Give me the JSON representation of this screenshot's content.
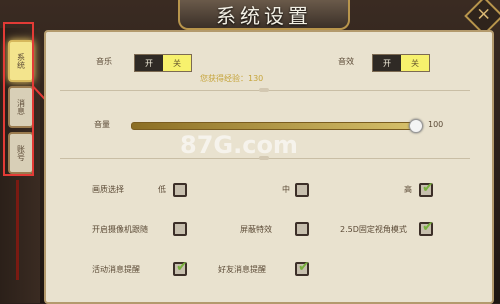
{
  "window": {
    "title": "系统设置",
    "close_icon": "close-icon"
  },
  "sidebar": {
    "tabs": [
      {
        "label": "系统",
        "active": true
      },
      {
        "label": "消息",
        "active": false
      },
      {
        "label": "账号",
        "active": false
      }
    ]
  },
  "sound": {
    "music_label": "音乐",
    "music_on": "开",
    "music_off": "关",
    "effects_label": "音效",
    "effects_on": "开",
    "effects_off": "关"
  },
  "info_text": "您获得经验：130",
  "volume": {
    "label": "音量",
    "value": "100",
    "level": 1.0
  },
  "quality": {
    "label": "画质选择",
    "low_label": "低",
    "mid_label": "中",
    "high_label": "高",
    "selected": "高"
  },
  "options": {
    "camera_follow_label": "开启摄像机跟随",
    "hide_effects_label": "屏蔽特效",
    "fixed_angle_label": "2.5D固定视角模式",
    "activity_alert_label": "活动消息提醒",
    "friend_alert_label": "好友消息提醒"
  },
  "watermark": {
    "text": "87G.com"
  },
  "colors": {
    "accent": "#f7f16d",
    "highlight": "#e33b36",
    "check": "#78b03d"
  }
}
